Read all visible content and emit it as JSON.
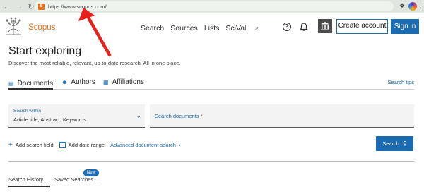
{
  "browser": {
    "back_icon": "back-arrow-icon",
    "forward_icon": "forward-arrow-icon",
    "reload_icon": "reload-icon",
    "url": "https://www.scopus.com/",
    "favicon_letter": "S",
    "extensions_icon": "puzzle-icon",
    "menu_icon": "menu-dots-icon"
  },
  "header": {
    "brand": "Scopus",
    "nav": [
      "Search",
      "Sources",
      "Lists",
      "SciVal"
    ],
    "scival_icon": "external-link-icon",
    "create_account": "Create account",
    "sign_in": "Sign in"
  },
  "main": {
    "title": "Start exploring",
    "subtitle": "Discover the most reliable, relevant, up-to-date research. All in one place.",
    "tabs": [
      {
        "label": "Documents",
        "icon": "document-icon",
        "active": true
      },
      {
        "label": "Authors",
        "icon": "person-icon",
        "active": false
      },
      {
        "label": "Affiliations",
        "icon": "building-icon",
        "active": false
      }
    ],
    "search_tips": "Search tips",
    "search_within_label": "Search within",
    "search_within_value": "Article title, Abstract, Keywords",
    "search_documents_label": "Search documents",
    "search_documents_required": "*",
    "add_search_field": "Add search field",
    "add_date_range": "Add date range",
    "advanced_search": "Advanced document search",
    "search_button": "Search"
  },
  "history": {
    "search_history": "Search History",
    "saved_searches": "Saved Searches",
    "new_badge": "New"
  },
  "colors": {
    "accent_blue": "#1a6bb0",
    "brand_orange": "#e9711c",
    "annotation_red": "#e8201c",
    "browser_bar": "#dfe6e0"
  }
}
